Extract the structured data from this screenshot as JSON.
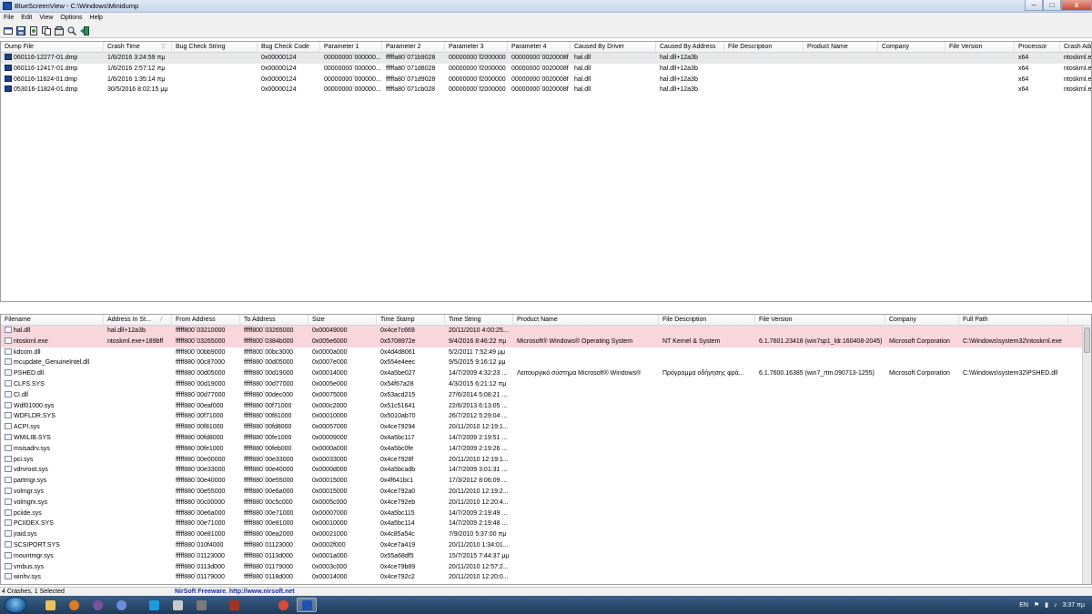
{
  "window": {
    "title": "BlueScreenView - C:\\Windows\\Minidump",
    "minimize": "–",
    "maximize": "□",
    "close": "x"
  },
  "menu": [
    "File",
    "Edit",
    "View",
    "Options",
    "Help"
  ],
  "toolbar": [
    "properties-icon",
    "save-icon",
    "html-report-icon",
    "copy-icon",
    "options-icon",
    "find-icon",
    "exit-icon"
  ],
  "crashes": {
    "columns": [
      "Dump File",
      "Crash Time",
      "Bug Check String",
      "Bug Check Code",
      "Parameter 1",
      "Parameter 2",
      "Parameter 3",
      "Parameter 4",
      "Caused By Driver",
      "Caused By Address",
      "File Description",
      "Product Name",
      "Company",
      "File Version",
      "Processor",
      "Crash Add"
    ],
    "sort_indicator": "▽",
    "rows": [
      [
        "060116-12277-01.dmp",
        "1/6/2016 3:24:59 πμ",
        "",
        "0x00000124",
        "00000000`000000...",
        "fffffa80`071b9028",
        "00000000`f2000000",
        "00000000`0020008f",
        "hal.dll",
        "hal.dll+12a3b",
        "",
        "",
        "",
        "",
        "x64",
        "ntoskrnl.e"
      ],
      [
        "060116-12417-01.dmp",
        "1/6/2016 2:57:12 πμ",
        "",
        "0x00000124",
        "00000000`000000...",
        "fffffa80`071d8028",
        "00000000`f2000000",
        "00000000`0020008f",
        "hal.dll",
        "hal.dll+12a3b",
        "",
        "",
        "",
        "",
        "x64",
        "ntoskrnl.e"
      ],
      [
        "060116-11824-01.dmp",
        "1/6/2016 1:35:14 πμ",
        "",
        "0x00000124",
        "00000000`000000...",
        "fffffa80`071d9028",
        "00000000`f2000000",
        "00000000`0020008f",
        "hal.dll",
        "hal.dll+12a3b",
        "",
        "",
        "",
        "",
        "x64",
        "ntoskrnl.e"
      ],
      [
        "053016-11824-01.dmp",
        "30/5/2016 8:02:15 μμ",
        "",
        "0x00000124",
        "00000000`000000...",
        "fffffa80`071cb028",
        "00000000`f2000000",
        "00000000`0020008f",
        "hal.dll",
        "hal.dll+12a3b",
        "",
        "",
        "",
        "",
        "x64",
        "ntoskrnl.e"
      ]
    ]
  },
  "modules": {
    "columns": [
      "Filename",
      "Address In St...",
      "From Address",
      "To Address",
      "Size",
      "Time Stamp",
      "Time String",
      "Product Name",
      "File Description",
      "File Version",
      "Company",
      "Full Path"
    ],
    "sort_indicator": "⁄",
    "rows": [
      [
        "hal.dll",
        "hal.dll+12a3b",
        "fffff800`03210000",
        "fffff800`03265000",
        "0x00049000",
        "0x4ce7c669",
        "20/11/2010 4:00:25...",
        "",
        "",
        "",
        "",
        ""
      ],
      [
        "ntoskrnl.exe",
        "ntoskrnl.exe+189bff",
        "fffff800`03265000",
        "fffff800`0384b000",
        "0x005e6000",
        "0x5708972e",
        "9/4/2016 8:46:22 πμ",
        "Microsoft® Windows® Operating System",
        "NT Kernel & System",
        "6.1.7601.23418 (win7sp1_ldr.160408-2045)",
        "Microsoft Corporation",
        "C:\\Windows\\system32\\ntoskrnl.exe"
      ],
      [
        "kdcom.dll",
        "",
        "fffff800`00bb9000",
        "fffff800`00bc3000",
        "0x0000a000",
        "0x4d4d8061",
        "5/2/2011 7:52:49 μμ",
        "",
        "",
        "",
        "",
        ""
      ],
      [
        "mcupdate_GenuineIntel.dll",
        "",
        "fffff880`00c87000",
        "fffff880`00d05000",
        "0x0007e000",
        "0x554e4eec",
        "9/5/2015 9:16:12 μμ",
        "",
        "",
        "",
        "",
        ""
      ],
      [
        "PSHED.dll",
        "",
        "fffff880`00d05000",
        "fffff880`00d19000",
        "0x00014000",
        "0x4a5be027",
        "14/7/2009 4:32:23 ...",
        "Λειτουργικό σύστημα Microsoft® Windows®",
        "Πρόγραμμα οδήγησης φρά...",
        "6.1.7600.16385 (win7_rtm.090713-1255)",
        "Microsoft Corporation",
        "C:\\Windows\\system32\\PSHED.dll"
      ],
      [
        "CLFS.SYS",
        "",
        "fffff880`00d19000",
        "fffff880`00d77000",
        "0x0005e000",
        "0x54f67a28",
        "4/3/2015 6:21:12 πμ",
        "",
        "",
        "",
        "",
        ""
      ],
      [
        "CI.dll",
        "",
        "fffff880`00d77000",
        "fffff880`00dec000",
        "0x00075000",
        "0x53acd215",
        "27/6/2014 5:08:21 ...",
        "",
        "",
        "",
        "",
        ""
      ],
      [
        "Wdf01000.sys",
        "",
        "fffff880`00eaf000",
        "fffff880`00f71000",
        "0x000c2000",
        "0x51c51641",
        "22/6/2013 6:13:05 ...",
        "",
        "",
        "",
        "",
        ""
      ],
      [
        "WDFLDR.SYS",
        "",
        "fffff880`00f71000",
        "fffff880`00f81000",
        "0x00010000",
        "0x5010ab70",
        "26/7/2012 5:29:04 ...",
        "",
        "",
        "",
        "",
        ""
      ],
      [
        "ACPI.sys",
        "",
        "fffff880`00f81000",
        "fffff880`00fd8000",
        "0x00057000",
        "0x4ce79294",
        "20/11/2010 12:19:1...",
        "",
        "",
        "",
        "",
        ""
      ],
      [
        "WMILIB.SYS",
        "",
        "fffff880`00fd8000",
        "fffff880`00fe1000",
        "0x00009000",
        "0x4a5bc117",
        "14/7/2009 2:19:51 ...",
        "",
        "",
        "",
        "",
        ""
      ],
      [
        "msisadrv.sys",
        "",
        "fffff880`00fe1000",
        "fffff880`00feb000",
        "0x0000a000",
        "0x4a5bc0fe",
        "14/7/2009 2:19:26 ...",
        "",
        "",
        "",
        "",
        ""
      ],
      [
        "pci.sys",
        "",
        "fffff880`00e00000",
        "fffff880`00e33000",
        "0x00033000",
        "0x4ce7928f",
        "20/11/2010 12:19:1...",
        "",
        "",
        "",
        "",
        ""
      ],
      [
        "vdrvroot.sys",
        "",
        "fffff880`00e33000",
        "fffff880`00e40000",
        "0x0000d000",
        "0x4a5bcadb",
        "14/7/2009 3:01:31 ...",
        "",
        "",
        "",
        "",
        ""
      ],
      [
        "partmgr.sys",
        "",
        "fffff880`00e40000",
        "fffff880`00e55000",
        "0x00015000",
        "0x4f641bc1",
        "17/3/2012 8:06:09 ...",
        "",
        "",
        "",
        "",
        ""
      ],
      [
        "volmgr.sys",
        "",
        "fffff880`00e55000",
        "fffff880`00e6a000",
        "0x00015000",
        "0x4ce792a0",
        "20/11/2010 12:19:2...",
        "",
        "",
        "",
        "",
        ""
      ],
      [
        "volmgrx.sys",
        "",
        "fffff880`00c00000",
        "fffff880`00c5c000",
        "0x0005c000",
        "0x4ce792eb",
        "20/11/2010 12:20:4...",
        "",
        "",
        "",
        "",
        ""
      ],
      [
        "pciide.sys",
        "",
        "fffff880`00e6a000",
        "fffff880`00e71000",
        "0x00007000",
        "0x4a5bc115",
        "14/7/2009 2:19:49 ...",
        "",
        "",
        "",
        "",
        ""
      ],
      [
        "PCIIDEX.SYS",
        "",
        "fffff880`00e71000",
        "fffff880`00e81000",
        "0x00010000",
        "0x4a5bc114",
        "14/7/2009 2:19:48 ...",
        "",
        "",
        "",
        "",
        ""
      ],
      [
        "jraid.sys",
        "",
        "fffff880`00e81000",
        "fffff880`00ea2000",
        "0x00021000",
        "0x4c85a54c",
        "7/9/2010 5:37:00 πμ",
        "",
        "",
        "",
        "",
        ""
      ],
      [
        "SCSIPORT.SYS",
        "",
        "fffff880`010f4000",
        "fffff880`01123000",
        "0x0002f000",
        "0x4ce7a419",
        "20/11/2010 1:34:01...",
        "",
        "",
        "",
        "",
        ""
      ],
      [
        "mountmgr.sys",
        "",
        "fffff880`01123000",
        "fffff880`0113d000",
        "0x0001a000",
        "0x55a68df5",
        "15/7/2015 7:44:37 μμ",
        "",
        "",
        "",
        "",
        ""
      ],
      [
        "vmbus.sys",
        "",
        "fffff880`0113d000",
        "fffff880`01179000",
        "0x0003c000",
        "0x4ce79b89",
        "20/11/2010 12:57:2...",
        "",
        "",
        "",
        "",
        ""
      ],
      [
        "winhv.sys",
        "",
        "fffff880`01179000",
        "fffff880`0118d000",
        "0x00014000",
        "0x4ce792c2",
        "20/11/2010 12:20:0...",
        "",
        "",
        "",
        "",
        ""
      ]
    ]
  },
  "status": {
    "summary": "4 Crashes, 1 Selected",
    "credit": "NirSoft Freeware.  http://www.nirsoft.net"
  },
  "taskbar": {
    "language": "EN",
    "time": "3:37 πμ",
    "items": [
      "explorer",
      "firefox",
      "viber",
      "chrome",
      "skype",
      "media",
      "tool",
      "app",
      "chrome2",
      "bluescreenview"
    ]
  }
}
